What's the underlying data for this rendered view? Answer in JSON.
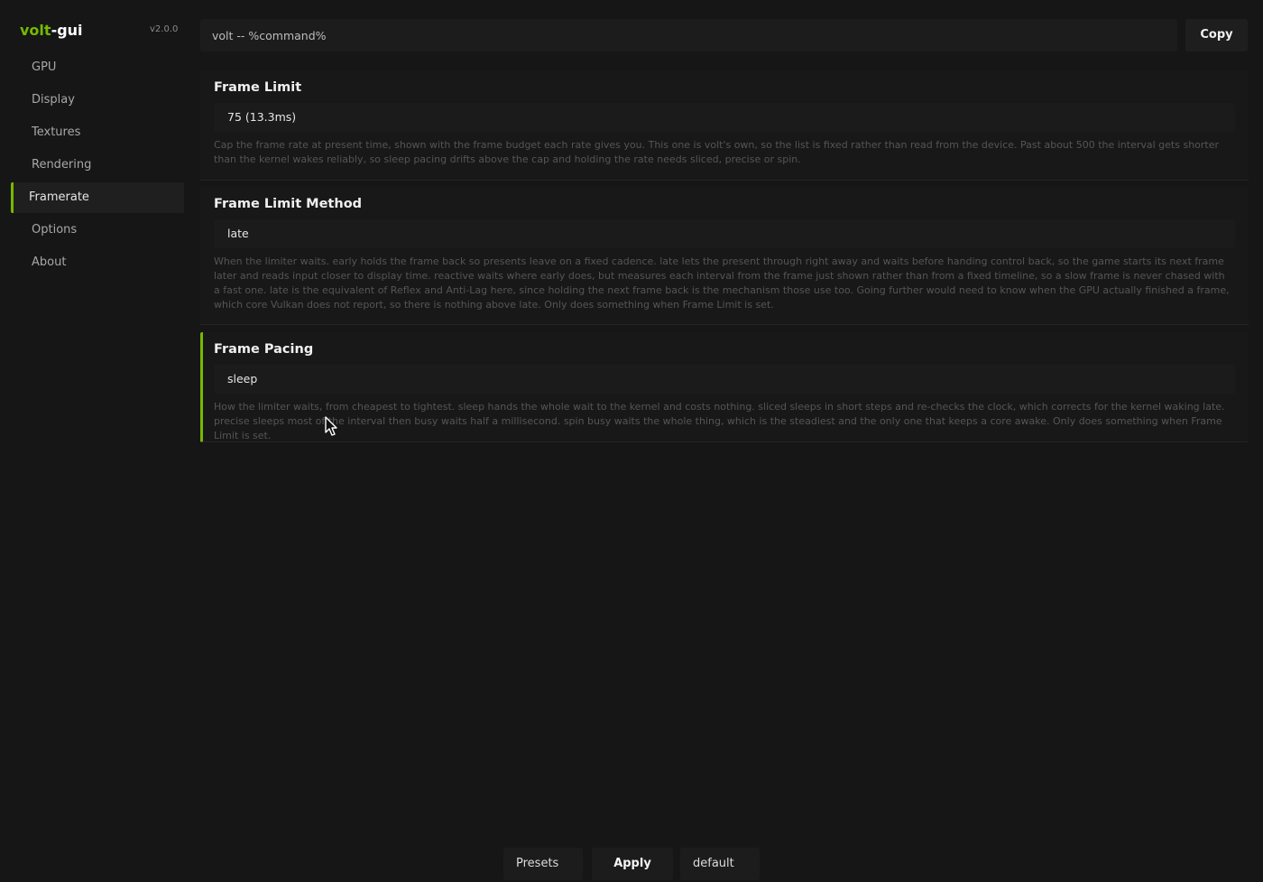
{
  "app": {
    "name_primary": "volt",
    "name_secondary": "-gui",
    "version": "v2.0.0",
    "accent_color": "#76b900"
  },
  "sidebar": {
    "items": [
      {
        "label": "GPU"
      },
      {
        "label": "Display"
      },
      {
        "label": "Textures"
      },
      {
        "label": "Rendering"
      },
      {
        "label": "Framerate",
        "active": true
      },
      {
        "label": "Options"
      },
      {
        "label": "About"
      }
    ]
  },
  "command": {
    "value": "volt -- %command%",
    "copy_label": "Copy"
  },
  "settings": [
    {
      "title": "Frame Limit",
      "value": "75 (13.3ms)",
      "description": "Cap the frame rate at present time, shown with the frame budget each rate gives you. This one is volt's own, so the list is fixed rather than read from the device. Past about 500 the interval gets shorter than the kernel wakes reliably, so sleep pacing drifts above the cap and holding the rate needs sliced, precise or spin."
    },
    {
      "title": "Frame Limit Method",
      "value": "late",
      "description": "When the limiter waits. early holds the frame back so presents leave on a fixed cadence. late lets the present through right away and waits before handing control back, so the game starts its next frame later and reads input closer to display time. reactive waits where early does, but measures each interval from the frame just shown rather than from a fixed timeline, so a slow frame is never chased with a fast one. late is the equivalent of Reflex and Anti-Lag here, since holding the next frame back is the mechanism those use too. Going further would need to know when the GPU actually finished a frame, which core Vulkan does not report, so there is nothing above late. Only does something when Frame Limit is set."
    },
    {
      "title": "Frame Pacing",
      "value": "sleep",
      "selected": true,
      "description": "How the limiter waits, from cheapest to tightest. sleep hands the whole wait to the kernel and costs nothing. sliced sleeps in short steps and re-checks the clock, which corrects for the kernel waking late. precise sleeps most of the interval then busy waits half a millisecond. spin busy waits the whole thing, which is the steadiest and the only one that keeps a core awake. Only does something when Frame Limit is set."
    }
  ],
  "footer": {
    "presets_label": "Presets",
    "apply_label": "Apply",
    "profile_value": "default"
  }
}
